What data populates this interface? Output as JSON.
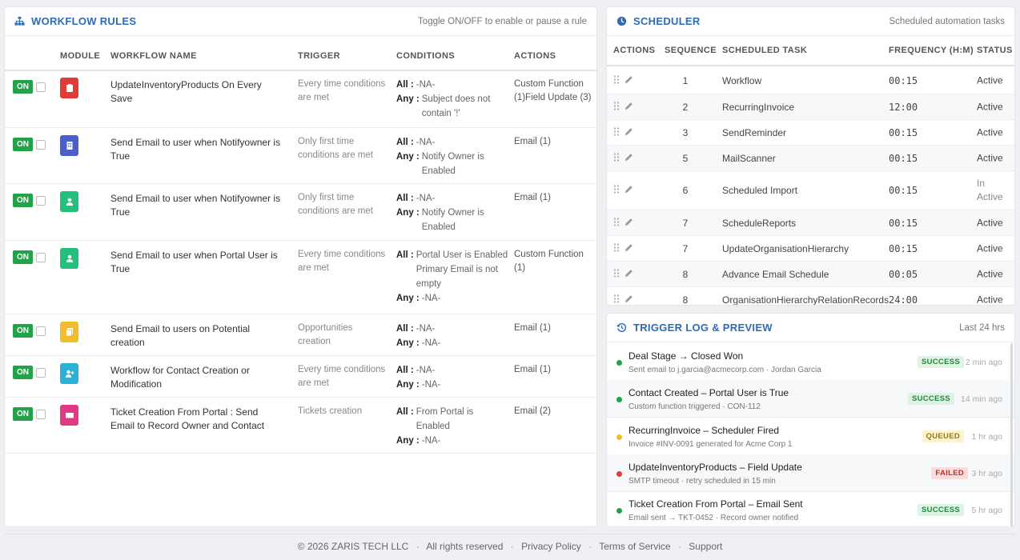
{
  "workflow": {
    "title": "WORKFLOW RULES",
    "subtitle": "Toggle ON/OFF to enable or pause a rule",
    "columns": {
      "module": "MODULE",
      "name": "WORKFLOW NAME",
      "trigger": "TRIGGER",
      "conditions": "CONDITIONS",
      "actions": "ACTIONS"
    },
    "on_label": "ON",
    "rows": [
      {
        "name": "UpdateInventoryProducts On Every Save",
        "trigger": "Every time conditions are met",
        "all_label": "All :",
        "all": "-NA-",
        "any_label": "Any :",
        "any": "Subject does not contain '!'",
        "actions": "Custom Function (1)Field Update (3)",
        "icon": "clipboard-icon",
        "color": "#e03b36"
      },
      {
        "name": "Send Email to user when Notifyowner is True",
        "trigger": "Only first time conditions are met",
        "all_label": "All :",
        "all": "-NA-",
        "any_label": "Any :",
        "any": "Notify Owner is Enabled",
        "actions": "Email (1)",
        "icon": "building-icon",
        "color": "#4a5fc9"
      },
      {
        "name": "Send Email to user when Notifyowner is True",
        "trigger": "Only first time conditions are met",
        "all_label": "All :",
        "all": "-NA-",
        "any_label": "Any :",
        "any": "Notify Owner is Enabled",
        "actions": "Email (1)",
        "icon": "user-icon",
        "color": "#22c07a"
      },
      {
        "name": "Send Email to user when Portal User is True",
        "trigger": "Every time conditions are met",
        "all_label": "All :",
        "all": "Portal User is Enabled Primary Email is not empty",
        "any_label": "Any :",
        "any": "-NA-",
        "actions": "Custom Function (1)",
        "icon": "user-icon",
        "color": "#22c07a"
      },
      {
        "name": "Send Email to users on Potential creation",
        "trigger": "Opportunities creation",
        "all_label": "All :",
        "all": "-NA-",
        "any_label": "Any :",
        "any": "-NA-",
        "actions": "Email (1)",
        "icon": "documents-icon",
        "color": "#f2bd2b"
      },
      {
        "name": "Workflow for Contact Creation or Modification",
        "trigger": "Every time conditions are met",
        "all_label": "All :",
        "all": "-NA-",
        "any_label": "Any :",
        "any": "-NA-",
        "actions": "Email (1)",
        "icon": "user-plus-icon",
        "color": "#2bb1d6"
      },
      {
        "name": "Ticket Creation From Portal : Send Email to Record Owner and Contact",
        "trigger": "Tickets creation",
        "all_label": "All :",
        "all": "From Portal is Enabled",
        "any_label": "Any :",
        "any": "-NA-",
        "actions": "Email (2)",
        "icon": "ticket-icon",
        "color": "#e03a86"
      }
    ]
  },
  "scheduler": {
    "title": "SCHEDULER",
    "subtitle": "Scheduled automation tasks",
    "columns": {
      "actions": "ACTIONS",
      "sequence": "SEQUENCE",
      "task": "SCHEDULED TASK",
      "frequency": "FREQUENCY (H:M)",
      "status": "STATUS"
    },
    "rows": [
      {
        "seq": "1",
        "task": "Workflow",
        "freq": "00:15",
        "status": "Active"
      },
      {
        "seq": "2",
        "task": "RecurringInvoice",
        "freq": "12:00",
        "status": "Active"
      },
      {
        "seq": "3",
        "task": "SendReminder",
        "freq": "00:15",
        "status": "Active"
      },
      {
        "seq": "5",
        "task": "MailScanner",
        "freq": "00:15",
        "status": "Active"
      },
      {
        "seq": "6",
        "task": "Scheduled Import",
        "freq": "00:15",
        "status": "In Active"
      },
      {
        "seq": "7",
        "task": "ScheduleReports",
        "freq": "00:15",
        "status": "Active"
      },
      {
        "seq": "7",
        "task": "UpdateOrganisationHierarchy",
        "freq": "00:15",
        "status": "Active"
      },
      {
        "seq": "8",
        "task": "Advance Email Schedule",
        "freq": "00:05",
        "status": "Active"
      },
      {
        "seq": "8",
        "task": "OrganisationHierarchyRelationRecords",
        "freq": "24:00",
        "status": "Active"
      }
    ]
  },
  "log": {
    "title": "TRIGGER LOG & PREVIEW",
    "subtitle": "Last 24 hrs",
    "entries": [
      {
        "title": "Deal Stage → Closed Won",
        "detail": "Sent email to j.garcia@acmecorp.com · Jordan Garcia",
        "status": "SUCCESS",
        "time": "2 min ago",
        "dot": "#22a249",
        "badge_bg": "#dff3e4",
        "badge_fg": "#1f8a3e"
      },
      {
        "title": "Contact Created – Portal User is True",
        "detail": "Custom function triggered · CON-112",
        "status": "SUCCESS",
        "time": "14 min ago",
        "dot": "#22a249",
        "badge_bg": "#dff3e4",
        "badge_fg": "#1f8a3e"
      },
      {
        "title": "RecurringInvoice – Scheduler Fired",
        "detail": "Invoice #INV-0091 generated for Acme Corp 1",
        "status": "QUEUED",
        "time": "1 hr ago",
        "dot": "#f2bd2b",
        "badge_bg": "#fdf3cf",
        "badge_fg": "#9a7a10"
      },
      {
        "title": "UpdateInventoryProducts – Field Update",
        "detail": "SMTP timeout · retry scheduled in 15 min",
        "status": "FAILED",
        "time": "3 hr ago",
        "dot": "#e03b36",
        "badge_bg": "#fadcdc",
        "badge_fg": "#c0302b"
      },
      {
        "title": "Ticket Creation From Portal – Email Sent",
        "detail": "Email sent → TKT-0452 · Record owner notified",
        "status": "SUCCESS",
        "time": "5 hr ago",
        "dot": "#22a249",
        "badge_bg": "#dff3e4",
        "badge_fg": "#1f8a3e"
      }
    ]
  },
  "footer": {
    "copyright": "© 2026 ZARIS TECH LLC",
    "rights": "All rights reserved",
    "privacy": "Privacy Policy",
    "terms": "Terms of Service",
    "support": "Support",
    "separator": "·"
  }
}
